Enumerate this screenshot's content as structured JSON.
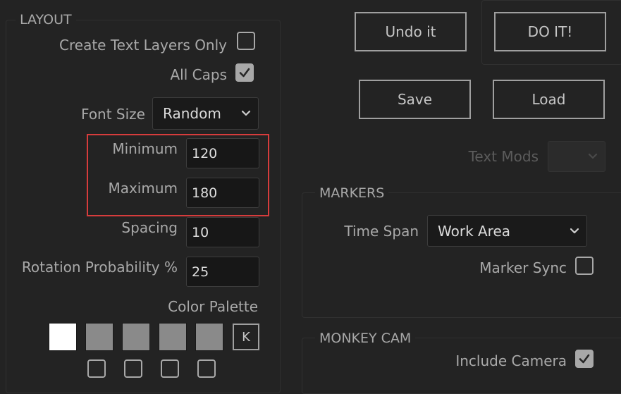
{
  "layout": {
    "legend": "LAYOUT",
    "create_text_layers_only": {
      "label": "Create Text Layers Only",
      "checked": false
    },
    "all_caps": {
      "label": "All Caps",
      "checked": true
    },
    "font_size": {
      "label": "Font Size",
      "value": "Random"
    },
    "minimum": {
      "label": "Minimum",
      "value": "120"
    },
    "maximum": {
      "label": "Maximum",
      "value": "180"
    },
    "spacing": {
      "label": "Spacing",
      "value": "10"
    },
    "rotation_probability": {
      "label": "Rotation Probability %",
      "value": "25"
    },
    "color_palette": {
      "label": "Color Palette",
      "swatches": [
        "#ffffff",
        "#8a8a8a",
        "#8a8a8a",
        "#8a8a8a",
        "#8a8a8a"
      ],
      "k_button_label": "K"
    }
  },
  "actions": {
    "undo_label": "Undo it",
    "do_it_label": "DO IT!",
    "save_label": "Save",
    "load_label": "Load",
    "text_mods_label": "Text Mods"
  },
  "markers": {
    "legend": "MARKERS",
    "time_span": {
      "label": "Time Span",
      "value": "Work Area"
    },
    "marker_sync": {
      "label": "Marker Sync",
      "checked": false
    }
  },
  "monkey_cam": {
    "legend": "MONKEY CAM",
    "include_camera": {
      "label": "Include Camera",
      "checked": true
    }
  },
  "colors": {
    "highlight": "#d63c3c",
    "background": "#232323"
  }
}
